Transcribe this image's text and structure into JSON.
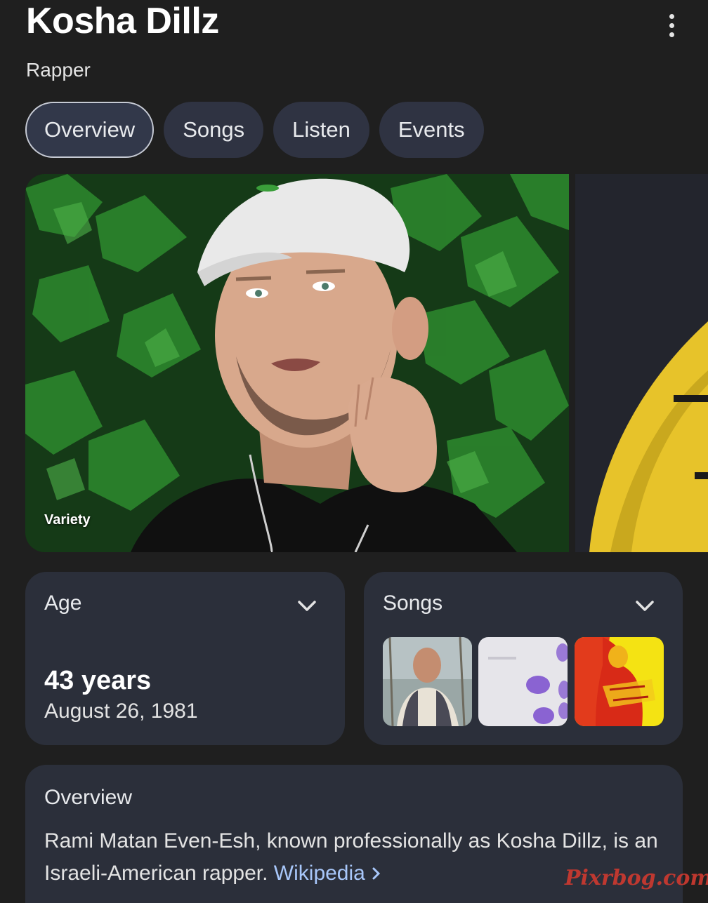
{
  "header": {
    "title": "Kosha Dillz",
    "subtitle": "Rapper"
  },
  "tabs": [
    {
      "label": "Overview",
      "active": true
    },
    {
      "label": "Songs",
      "active": false
    },
    {
      "label": "Listen",
      "active": false
    },
    {
      "label": "Events",
      "active": false
    }
  ],
  "gallery": {
    "main_photo_credit": "Variety"
  },
  "age_card": {
    "title": "Age",
    "value": "43 years",
    "date": "August 26, 1981"
  },
  "songs_card": {
    "title": "Songs"
  },
  "overview_card": {
    "title": "Overview",
    "text": "Rami Matan Even-Esh, known professionally as Kosha Dillz, is an Israeli-American rapper. ",
    "link_label": "Wikipedia"
  },
  "watermark": "Pixrbog.com",
  "colors": {
    "background": "#1f1f1f",
    "card": "#2b2f3a",
    "tab": "#2f3342",
    "link": "#a8c7fa"
  }
}
